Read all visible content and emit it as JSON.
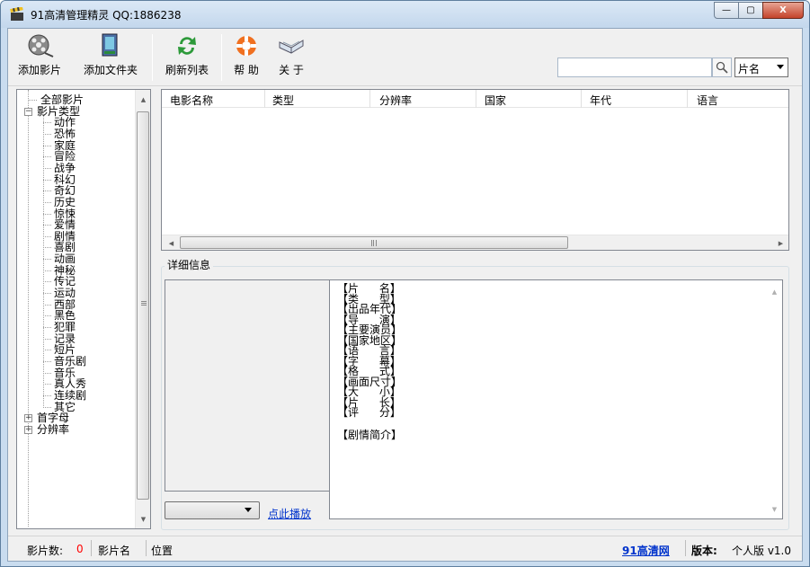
{
  "window": {
    "title": "91高清管理精灵  QQ:1886238",
    "min": "—",
    "max": "▢",
    "close": "X"
  },
  "toolbar": {
    "add_movie": "添加影片",
    "add_folder": "添加文件夹",
    "refresh": "刷新列表",
    "help": "帮 助",
    "about": "关 于"
  },
  "search": {
    "value": "",
    "field": "片名"
  },
  "tree": {
    "all": "全部影片",
    "types": "影片类型",
    "genres": [
      "动作",
      "恐怖",
      "家庭",
      "冒险",
      "战争",
      "科幻",
      "奇幻",
      "历史",
      "惊悚",
      "爱情",
      "剧情",
      "喜剧",
      "动画",
      "神秘",
      "传记",
      "运动",
      "西部",
      "黑色",
      "犯罪",
      "记录",
      "短片",
      "音乐剧",
      "音乐",
      "真人秀",
      "连续剧",
      "其它"
    ],
    "initial": "首字母",
    "resolution": "分辨率"
  },
  "list": {
    "columns": [
      "电影名称",
      "类型",
      "分辨率",
      "国家",
      "年代",
      "语言"
    ]
  },
  "detail": {
    "group_title": "详细信息",
    "play_link": "点此播放",
    "fields": [
      "【片      名】",
      "【类      型】",
      "【出品年代】",
      "【导      演】",
      "【主要演员】",
      "【国家地区】",
      "【语      言】",
      "【字      幕】",
      "【格      式】",
      "【画面尺寸】",
      "【大      小】",
      "【片      长】",
      "【评      分】"
    ],
    "synopsis": "【剧情简介】"
  },
  "status": {
    "count_label": "影片数:",
    "count": "0",
    "name_label": "影片名",
    "position_label": "位置",
    "site_link": "91高清网",
    "version_label": "版本:",
    "version": "个人版 v1.0"
  },
  "colors": {
    "count": "#ff0000",
    "link": "#0033cc"
  }
}
